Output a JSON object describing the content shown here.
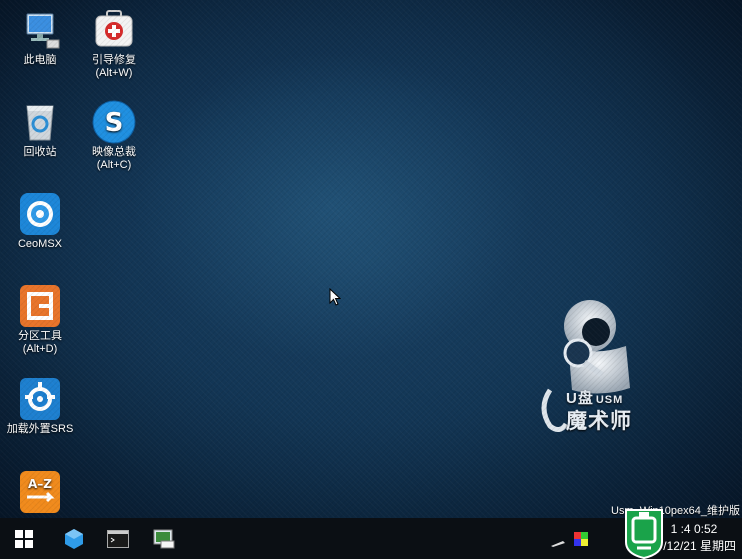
{
  "desktop": {
    "icons": [
      {
        "label": "此电脑",
        "label2": ""
      },
      {
        "label": "引导修复",
        "label2": "(Alt+W)"
      },
      {
        "label": "回收站",
        "label2": ""
      },
      {
        "label": "映像总裁",
        "label2": "(Alt+C)"
      },
      {
        "label": "CeoMSX",
        "label2": ""
      },
      {
        "label": "分区工具",
        "label2": "(Alt+D)"
      },
      {
        "label": "加载外置SRS",
        "label2": ""
      },
      {
        "label": "",
        "label2": ""
      }
    ],
    "icon_names": [
      "this-pc-icon",
      "boot-repair-icon",
      "recycle-bin-icon",
      "image-ceo-icon",
      "ceomsx-icon",
      "partition-tool-icon",
      "load-srs-icon",
      "a-z-icon"
    ],
    "brand_top": "U盘",
    "brand_top_small": "USM",
    "brand_bottom": "魔术师",
    "version_text": "Usm_Win10pex64_维护版"
  },
  "taskbar": {
    "items": [
      "start-icon",
      "app-icon",
      "console-icon",
      "explorer-icon"
    ],
    "tray_icons": [
      "pen-icon",
      "color-icon"
    ],
    "clock_time": "1 :4 0:52",
    "clock_date": "2017/12/21 星期四"
  }
}
